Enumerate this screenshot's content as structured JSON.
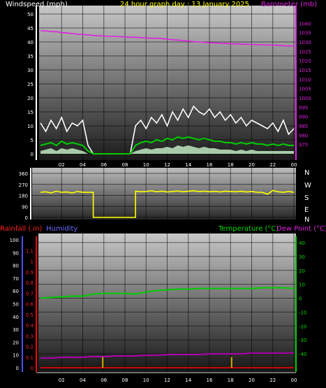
{
  "header": {
    "wind_label": "Windspeed (mph)",
    "title": "24 hour graph day : 13 January 2025",
    "baro_label": "Barometer (mb)",
    "rain_label": "Rainfall (.in)",
    "humidity_label": "Humidity",
    "temp_label": "Temperature (°C)",
    "dew_label": "Dew Point (°C)"
  },
  "colors": {
    "wind": "#ffffff",
    "wind_avg": "#00cc00",
    "wind_fill": "#bfe8bf",
    "baro": "#e020e0",
    "direction": "#ffff00",
    "temp": "#00cc00",
    "dew": "#b000b0",
    "rain": "#ff0000",
    "humidity": "#5050ff",
    "rain_marker": "#d4b000"
  },
  "x_ticks": [
    "02",
    "04",
    "06",
    "08",
    "10",
    "12",
    "14",
    "16",
    "18",
    "20",
    "22",
    "00"
  ],
  "compass": [
    "N",
    "W",
    "S",
    "E",
    "N"
  ],
  "chart_data": [
    {
      "type": "line",
      "title": "24 hour graph day : 13 January 2025",
      "ylabel": "Windspeed (mph)",
      "ylim": [
        0,
        50
      ],
      "y_ticks": [
        "0",
        "5",
        "10",
        "15",
        "20",
        "25",
        "30",
        "35",
        "40",
        "45",
        "50"
      ],
      "y2label": "Barometer (mb)",
      "y2lim": [
        970,
        1045
      ],
      "y2_ticks": [
        "975",
        "980",
        "985",
        "990",
        "995",
        "1000",
        "1005",
        "1010",
        "1015",
        "1020",
        "1025",
        "1030",
        "1035",
        "1040"
      ],
      "x": [
        0,
        0.5,
        1,
        1.5,
        2,
        2.5,
        3,
        3.5,
        4,
        4.5,
        5,
        5.5,
        6,
        6.5,
        7,
        7.5,
        8,
        8.5,
        9,
        9.5,
        10,
        10.5,
        11,
        11.5,
        12,
        12.5,
        13,
        13.5,
        14,
        14.5,
        15,
        15.5,
        16,
        16.5,
        17,
        17.5,
        18,
        18.5,
        19,
        19.5,
        20,
        20.5,
        21,
        21.5,
        22,
        22.5,
        23,
        23.5,
        24
      ],
      "series": [
        {
          "name": "Windspeed (mph)",
          "role": "gust",
          "values": [
            11,
            8,
            12,
            9,
            13,
            8,
            11,
            10,
            12,
            3,
            0,
            0,
            0,
            0,
            0,
            0,
            0,
            0,
            10,
            12,
            9,
            13,
            11,
            14,
            10,
            15,
            12,
            16,
            13,
            17,
            15,
            14,
            16,
            13,
            15,
            12,
            14,
            11,
            13,
            10,
            12,
            11,
            10,
            9,
            11,
            8,
            12,
            7,
            9
          ]
        },
        {
          "name": "Windspeed (mph)",
          "role": "average",
          "values": [
            3,
            3.5,
            4,
            3,
            4.5,
            3.5,
            4,
            3.5,
            3,
            1,
            0,
            0,
            0,
            0,
            0,
            0,
            0,
            0,
            3,
            4,
            4.5,
            4,
            5,
            4.5,
            5.5,
            5,
            6,
            5.5,
            6,
            5.5,
            5,
            5.5,
            5,
            4.5,
            4.5,
            4,
            4,
            3.5,
            4,
            3.5,
            4,
            3.5,
            3.5,
            3,
            3.5,
            3,
            3.5,
            3,
            3
          ]
        },
        {
          "name": "Windspeed (mph)",
          "role": "lull",
          "values": [
            1,
            1.5,
            2,
            1,
            2,
            1.5,
            2,
            1.5,
            1,
            0,
            0,
            0,
            0,
            0,
            0,
            0,
            0,
            0,
            1,
            1.5,
            2,
            1.5,
            2,
            2,
            2.5,
            2,
            3,
            2.5,
            3,
            2.5,
            2,
            2.5,
            2,
            2,
            1.5,
            1.5,
            1.5,
            1,
            1.5,
            1,
            1.5,
            1,
            1,
            1,
            1,
            1,
            1,
            1,
            1
          ]
        },
        {
          "name": "Barometer (mb)",
          "axis": "y2",
          "values": [
            1036,
            1036,
            1035.5,
            1035.5,
            1035,
            1034.8,
            1034.5,
            1034.2,
            1034,
            1033.8,
            1033.5,
            1033.3,
            1033.2,
            1033,
            1033,
            1032.8,
            1032.7,
            1032.5,
            1032.5,
            1032.3,
            1032.2,
            1032,
            1032,
            1031.8,
            1031.5,
            1031.2,
            1031,
            1030.7,
            1030.5,
            1030.2,
            1030,
            1029.8,
            1029.5,
            1029.5,
            1029.3,
            1029.2,
            1029,
            1029,
            1028.8,
            1028.8,
            1028.7,
            1028.5,
            1028.5,
            1028.3,
            1028.3,
            1028.2,
            1028,
            1027.8,
            1028
          ]
        }
      ]
    },
    {
      "type": "line",
      "ylim": [
        0,
        360
      ],
      "y_ticks": [
        "0",
        "90",
        "180",
        "270",
        "360"
      ],
      "series": [
        {
          "name": "Wind direction",
          "x": [
            0,
            0.5,
            1,
            1.5,
            2,
            2.5,
            3,
            3.5,
            4,
            4.5,
            5,
            5,
            9,
            9,
            9.5,
            10,
            10.5,
            11,
            11.5,
            12,
            12.5,
            13,
            13.5,
            14,
            14.5,
            15,
            15.5,
            16,
            16.5,
            17,
            17.5,
            18,
            18.5,
            19,
            19.5,
            20,
            20.5,
            21,
            21.5,
            22,
            22.5,
            23,
            23.5,
            24
          ],
          "values": [
            205,
            210,
            200,
            215,
            205,
            208,
            200,
            212,
            205,
            205,
            205,
            0,
            0,
            215,
            210,
            212,
            218,
            210,
            215,
            208,
            212,
            216,
            210,
            214,
            218,
            212,
            215,
            210,
            213,
            208,
            215,
            212,
            210,
            214,
            208,
            212,
            206,
            205,
            190,
            220,
            210,
            205,
            212,
            205
          ]
        }
      ]
    },
    {
      "type": "line",
      "ylabel": "Rainfall (.in)",
      "ylim": [
        0,
        1.2
      ],
      "y_ticks": [
        "0",
        "0.1",
        "0.2",
        "0.3",
        "0.4",
        "0.5",
        "0.6",
        "0.7",
        "0.8",
        "0.9",
        "1",
        "1.1"
      ],
      "y_humidity_ticks": [
        "0",
        "10",
        "20",
        "30",
        "40",
        "50",
        "60",
        "70",
        "80",
        "90",
        "100"
      ],
      "y2label": "Temperature (°C)",
      "y2lim": [
        -50,
        42
      ],
      "y2_ticks": [
        "-40",
        "-30",
        "-20",
        "-10",
        "0",
        "10",
        "20",
        "30",
        "40"
      ],
      "x": [
        0,
        1,
        2,
        3,
        4,
        5,
        6,
        7,
        8,
        9,
        10,
        11,
        12,
        13,
        14,
        15,
        16,
        17,
        18,
        19,
        20,
        21,
        22,
        23,
        24
      ],
      "series": [
        {
          "name": "Temperature (°C)",
          "axis": "y2",
          "values": [
            0,
            0.5,
            1,
            1.5,
            1.5,
            3,
            3.5,
            3.5,
            3.5,
            3,
            4.5,
            5.5,
            6,
            6.5,
            6.5,
            7,
            7,
            7,
            7,
            7,
            7,
            7.5,
            7.5,
            7.5,
            7
          ]
        },
        {
          "name": "Dew Point (°C)",
          "axis": "y2",
          "values": [
            -43,
            -43,
            -42.5,
            -42.5,
            -42.5,
            -42,
            -42,
            -41.5,
            -41.5,
            -41.5,
            -41,
            -41,
            -40.5,
            -40.5,
            -40.5,
            -40.5,
            -40,
            -40,
            -40,
            -40,
            -39.5,
            -39.5,
            -39.5,
            -39.5,
            -39.5
          ]
        },
        {
          "name": "Rainfall (.in)",
          "values": [
            0,
            0,
            0,
            0,
            0,
            0,
            0,
            0,
            0,
            0,
            0,
            0,
            0,
            0,
            0,
            0,
            0,
            0,
            0,
            0,
            0,
            0,
            0,
            0,
            0
          ]
        }
      ],
      "markers": [
        {
          "x": 5.9,
          "value": 0.1
        },
        {
          "x": 18.1,
          "value": 0.1
        }
      ]
    }
  ]
}
